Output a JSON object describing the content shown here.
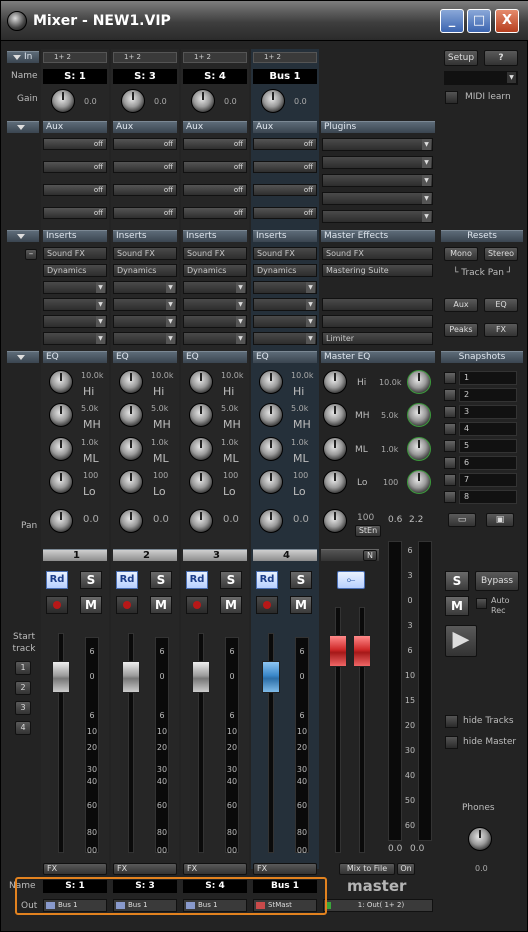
{
  "window": {
    "title": "Mixer - NEW1.VIP",
    "min": "_",
    "max": "□",
    "close": "X"
  },
  "sections": {
    "in": "In",
    "name": "Name",
    "gain": "Gain",
    "aux": "Aux",
    "plugins": "Plugins",
    "inserts": "Inserts",
    "master_effects": "Master Effects",
    "resets": "Resets",
    "eq": "EQ",
    "master_eq": "Master EQ",
    "snapshots": "Snapshots",
    "pan": "Pan",
    "start_track": "Start track",
    "out": "Out",
    "name_bottom": "Name"
  },
  "channels": [
    {
      "num": "1",
      "input": "1+ 2",
      "name": "S: 1",
      "gain": "0.0",
      "aux": [
        "off",
        "off",
        "off",
        "off"
      ],
      "inserts": [
        "Sound FX",
        "Dynamics"
      ],
      "eq": {
        "hi": "10.0k",
        "hi_lbl": "Hi",
        "mh": "5.0k",
        "mh_lbl": "MH",
        "ml": "1.0k",
        "ml_lbl": "ML",
        "lo": "100",
        "lo_lbl": "Lo"
      },
      "pan": "0.0",
      "rd": "Rd",
      "s": "S",
      "m": "M",
      "fx": "FX",
      "out": "Bus 1",
      "bottom_name": "S: 1"
    },
    {
      "num": "2",
      "input": "1+ 2",
      "name": "S: 3",
      "gain": "0.0",
      "aux": [
        "off",
        "off",
        "off",
        "off"
      ],
      "inserts": [
        "Sound FX",
        "Dynamics"
      ],
      "eq": {
        "hi": "10.0k",
        "hi_lbl": "Hi",
        "mh": "5.0k",
        "mh_lbl": "MH",
        "ml": "1.0k",
        "ml_lbl": "ML",
        "lo": "100",
        "lo_lbl": "Lo"
      },
      "pan": "0.0",
      "rd": "Rd",
      "s": "S",
      "m": "M",
      "fx": "FX",
      "out": "Bus 1",
      "bottom_name": "S: 3"
    },
    {
      "num": "3",
      "input": "1+ 2",
      "name": "S: 4",
      "gain": "0.0",
      "aux": [
        "off",
        "off",
        "off",
        "off"
      ],
      "inserts": [
        "Sound FX",
        "Dynamics"
      ],
      "eq": {
        "hi": "10.0k",
        "hi_lbl": "Hi",
        "mh": "5.0k",
        "mh_lbl": "MH",
        "ml": "1.0k",
        "ml_lbl": "ML",
        "lo": "100",
        "lo_lbl": "Lo"
      },
      "pan": "0.0",
      "rd": "Rd",
      "s": "S",
      "m": "M",
      "fx": "FX",
      "out": "Bus 1",
      "bottom_name": "S: 4"
    },
    {
      "num": "4",
      "input": "1+ 2",
      "name": "Bus 1",
      "gain": "0.0",
      "aux": [
        "off",
        "off",
        "off",
        "off"
      ],
      "inserts": [
        "Sound FX",
        "Dynamics"
      ],
      "eq": {
        "hi": "10.0k",
        "hi_lbl": "Hi",
        "mh": "5.0k",
        "mh_lbl": "MH",
        "ml": "1.0k",
        "ml_lbl": "ML",
        "lo": "100",
        "lo_lbl": "Lo"
      },
      "pan": "0.0",
      "rd": "Rd",
      "s": "S",
      "m": "M",
      "fx": "FX",
      "out": "StMast",
      "bottom_name": "Bus 1"
    }
  ],
  "fader_scale": [
    "6",
    "0",
    "6",
    "10",
    "20",
    "30",
    "40",
    "60",
    "80",
    "00"
  ],
  "master_scale": [
    "6",
    "3",
    "0",
    "3",
    "6",
    "10",
    "15",
    "20",
    "30",
    "40",
    "50",
    "60"
  ],
  "master": {
    "effects": [
      "Sound FX",
      "Mastering Suite",
      "",
      "",
      "Limiter"
    ],
    "eq": [
      {
        "lbl": "Hi",
        "val": "10.0k"
      },
      {
        "lbl": "MH",
        "val": "5.0k"
      },
      {
        "lbl": "ML",
        "val": "1.0k"
      },
      {
        "lbl": "Lo",
        "val": "100"
      }
    ],
    "pan_val": "100",
    "sten": "StEn",
    "n": "N",
    "meter_top": [
      "0.6",
      "2.2"
    ],
    "meter_bottom": [
      "0.0",
      "0.0"
    ],
    "mix_to_file": "Mix to File",
    "on": "On",
    "label": "master",
    "out": "1: Out( 1+ 2)"
  },
  "right": {
    "setup": "Setup",
    "help": "?",
    "midi_learn": "MIDI learn",
    "resets": {
      "mono": "Mono",
      "stereo": "Stereo",
      "track_pan": "Track Pan",
      "aux": "Aux",
      "eq": "EQ",
      "peaks": "Peaks",
      "fx": "FX"
    },
    "snapshots": [
      "1",
      "2",
      "3",
      "4",
      "5",
      "6",
      "7",
      "8"
    ],
    "s": "S",
    "m": "M",
    "bypass": "Bypass",
    "auto_rec": "Auto Rec",
    "hide_tracks": "hide Tracks",
    "hide_master": "hide Master",
    "phones": "Phones",
    "phones_val": "0.0"
  },
  "start_track": [
    "1",
    "2",
    "3",
    "4"
  ]
}
